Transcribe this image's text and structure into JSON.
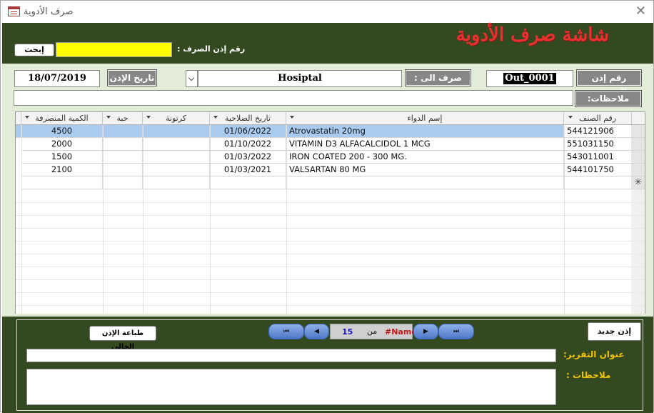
{
  "window": {
    "title": "صرف الأدوية",
    "close_glyph": "✕"
  },
  "header": {
    "title": "شاشة صرف الأدوية",
    "search_label": "رقم إذن الصرف :",
    "search_value": "",
    "search_button": "إبحث",
    "search_color": "#ffff00"
  },
  "form": {
    "out_no_label": "رقم إذن الصرف :",
    "out_no_value": "Out_0001",
    "issue_to_label": "صرف الى :",
    "issue_to_value": "Hosiptal",
    "date_label": "تاريخ الإذن :",
    "date_value": "18/07/2019",
    "notes_label": "ملاحظات:",
    "notes_value": ""
  },
  "grid": {
    "columns": [
      "رقم الصنف",
      "إسم الدواء",
      "تاريخ الصلاحية",
      "كرتونة",
      "حبة",
      "الكمية المنصرفة"
    ],
    "rows": [
      {
        "code": "544121906",
        "name": "Atrovastatin 20mg",
        "expiry": "01/06/2022",
        "carton": "",
        "pill": "",
        "qty": "4500"
      },
      {
        "code": "551031150",
        "name": "VITAMIN D3 ALFACALCIDOL 1 MCG",
        "expiry": "01/10/2022",
        "carton": "",
        "pill": "",
        "qty": "2000"
      },
      {
        "code": "543011001",
        "name": "IRON COATED 200 - 300 MG.",
        "expiry": "01/03/2022",
        "carton": "",
        "pill": "",
        "qty": "1500"
      },
      {
        "code": "544101750",
        "name": "VALSARTAN 80 MG",
        "expiry": "01/03/2021",
        "carton": "",
        "pill": "",
        "qty": "2100"
      }
    ],
    "new_row_marker": "✳",
    "selected_color": "#a9cbef"
  },
  "footer": {
    "print_button": "طباعة الإذن الحالى",
    "new_button": "إذن جديد",
    "nav": {
      "first": "⏮",
      "prev": "◀",
      "next": "▶",
      "last": "⏭",
      "record": "15",
      "of": "من",
      "name": "#Name?"
    },
    "report_title_label": "عنوان التقرير:",
    "report_title_value": "",
    "notes_label": "ملاحظات :",
    "notes_value": ""
  },
  "colors": {
    "panel": "#33491f",
    "form_bg": "#e2ecd6",
    "title_red": "#e8312f",
    "label_yellow": "#f2c400"
  }
}
